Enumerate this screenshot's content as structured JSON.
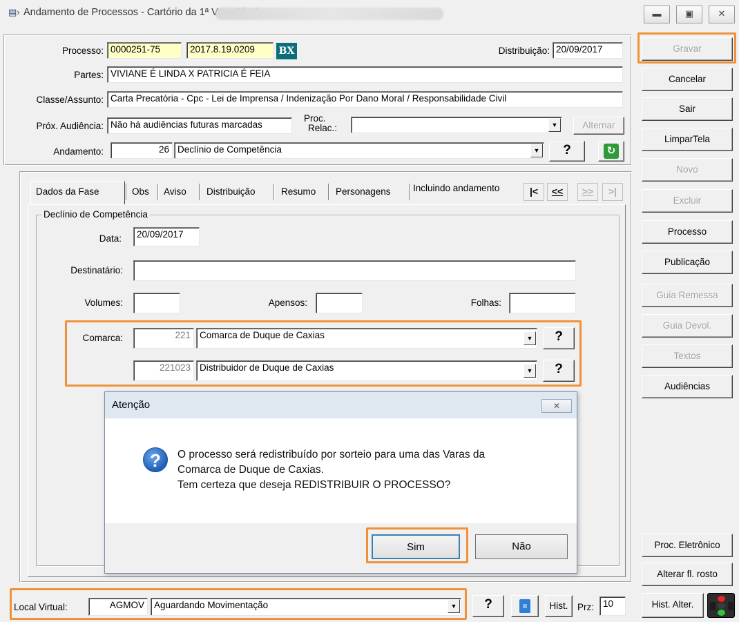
{
  "window": {
    "title": "Andamento de Processos - Cartório da 1ª Vara Cível",
    "app_icon": "app-icon",
    "controls": [
      "minimize",
      "maximize",
      "close"
    ]
  },
  "header": {
    "processo_label": "Processo:",
    "processo_num": "0000251-75",
    "processo_num2": "2017.8.19.0209",
    "bx": "BX",
    "distribuicao_label": "Distribuição:",
    "distribuicao_value": "20/09/2017",
    "partes_label": "Partes:",
    "partes_value": "VIVIANE É LINDA X PATRICIA É FEIA",
    "classe_label": "Classe/Assunto:",
    "classe_value": "Carta Precatória - Cpc - Lei de Imprensa / Indenização Por Dano Moral / Responsabilidade Civil",
    "prox_label": "Próx. Audiência:",
    "prox_value": "Não há audiências futuras marcadas",
    "proc_relac_label1": "Proc.",
    "proc_relac_label2": "Relac.:",
    "proc_relac_value": "",
    "alternar": "Alternar",
    "andamento_label": "Andamento:",
    "andamento_code": "26",
    "andamento_value": "Declínio de Competência",
    "help": "?"
  },
  "tabs": {
    "items": [
      "Dados da Fase",
      "Obs",
      "Aviso",
      "Distribuição",
      "Resumo",
      "Personagens"
    ],
    "status": "Incluindo andamento",
    "nav": [
      "|<",
      "<<",
      ">>",
      ">|"
    ]
  },
  "form": {
    "group_title": "Declínio de Competência",
    "data_label": "Data:",
    "data_value": "20/09/2017",
    "destinatario_label": "Destinatário:",
    "destinatario_value": "",
    "volumes_label": "Volumes:",
    "volumes_value": "",
    "apensos_label": "Apensos:",
    "apensos_value": "",
    "folhas_label": "Folhas:",
    "folhas_value": "",
    "comarca_label": "Comarca:",
    "comarca_code": "221",
    "comarca_value": "Comarca de Duque de Caxias",
    "distrib_code": "221023",
    "distrib_value": "Distribuidor de Duque de Caxias"
  },
  "sidebar": {
    "buttons": [
      {
        "label": "Gravar",
        "enabled": false
      },
      {
        "label": "Cancelar",
        "enabled": true
      },
      {
        "label": "Sair",
        "enabled": true
      },
      {
        "label": "LimparTela",
        "enabled": true
      },
      {
        "label": "Novo",
        "enabled": false
      },
      {
        "label": "Excluir",
        "enabled": false
      },
      {
        "label": "Processo",
        "enabled": true
      },
      {
        "label": "Publicação",
        "enabled": true
      },
      {
        "label": "Guia Remessa",
        "enabled": false
      },
      {
        "label": "Guia Devol.",
        "enabled": false
      },
      {
        "label": "Textos",
        "enabled": false
      },
      {
        "label": "Audiências",
        "enabled": true
      }
    ],
    "bottom": [
      "Proc. Eletrônico",
      "Alterar fl. rosto",
      "Hist. Alter."
    ]
  },
  "footer": {
    "local_label": "Local Virtual:",
    "local_code": "AGMOV",
    "local_value": "Aguardando Movimentação",
    "hist": "Hist.",
    "prz_label": "Prz:",
    "prz_value": "10"
  },
  "dialog": {
    "title": "Atenção",
    "close": "✕",
    "message_line1": "O processo será redistribuído por sorteio para uma das Varas da",
    "message_line2": "Comarca de Duque de Caxias.",
    "message_line3": "Tem certeza que deseja REDISTRIBUIR O PROCESSO?",
    "yes": "Sim",
    "no": "Não"
  },
  "colors": {
    "highlight": "#f0913a",
    "yellow_field": "#ffffc8",
    "bx_teal": "#0b6e7a"
  }
}
